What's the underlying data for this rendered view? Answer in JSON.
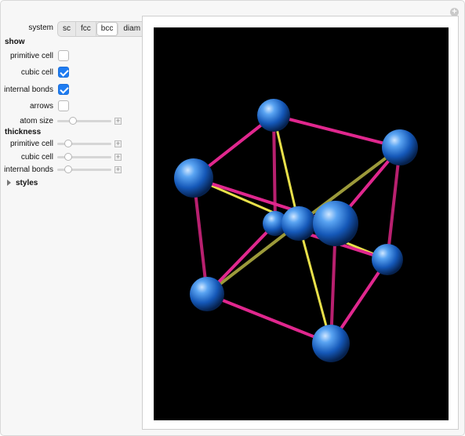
{
  "controls": {
    "system_label": "system",
    "system_options": [
      "sc",
      "fcc",
      "bcc",
      "diam"
    ],
    "system_selected": "bcc",
    "show_label": "show",
    "primitive_cell_label": "primitive cell",
    "primitive_cell_checked": false,
    "cubic_cell_label": "cubic cell",
    "cubic_cell_checked": true,
    "internal_bonds_label": "internal bonds",
    "internal_bonds_checked": true,
    "arrows_label": "arrows",
    "arrows_checked": false,
    "atom_size_label": "atom size",
    "atom_size_level": 0.25,
    "thickness_label": "thickness",
    "thickness_primitive_label": "primitive cell",
    "thickness_primitive_level": 0.15,
    "thickness_cubic_label": "cubic cell",
    "thickness_cubic_level": 0.15,
    "thickness_internal_label": "internal bonds",
    "thickness_internal_level": 0.15,
    "styles_label": "styles"
  },
  "scene": {
    "background": "#000000",
    "atom_color": "#1f6fd6",
    "cubic_bond_color": "#e0278e",
    "internal_bond_color": "#e8e04a"
  },
  "icons": {
    "corner": "plus-circle-icon",
    "expand": "chevron-right-icon",
    "slider_plus": "plus-box-icon"
  }
}
